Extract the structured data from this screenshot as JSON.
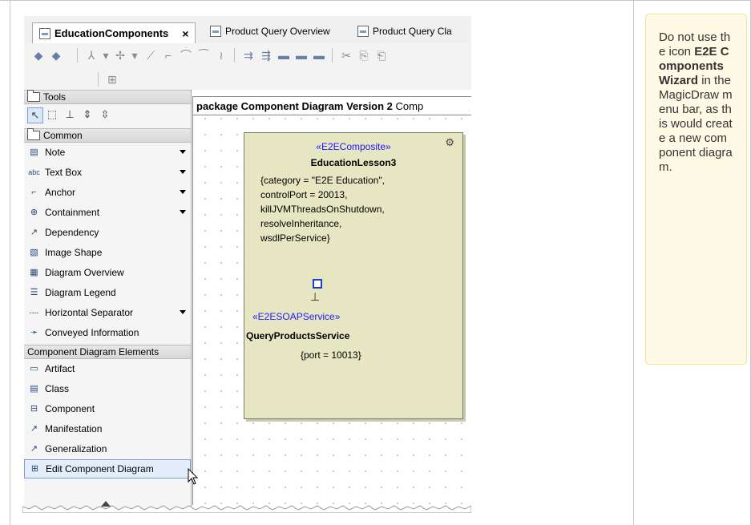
{
  "tabs": [
    {
      "label": "EducationComponents",
      "close": "×",
      "active": true
    },
    {
      "label": "Product Query Overview"
    },
    {
      "label": "Product Query Cla"
    }
  ],
  "palette": {
    "groups": [
      {
        "label": "Tools"
      },
      {
        "label": "Common"
      },
      {
        "label": "Component Diagram Elements"
      }
    ],
    "common_items": [
      {
        "label": "Note",
        "icon": "note-icon",
        "glyph": "▤",
        "dropdown": true
      },
      {
        "label": "Text Box",
        "icon": "text-box-icon",
        "glyph": "abc",
        "dropdown": true
      },
      {
        "label": "Anchor",
        "icon": "anchor-icon",
        "glyph": "⌐",
        "dropdown": true
      },
      {
        "label": "Containment",
        "icon": "containment-icon",
        "glyph": "⊕",
        "dropdown": true
      },
      {
        "label": "Dependency",
        "icon": "dependency-icon",
        "glyph": "↗",
        "dropdown": false
      },
      {
        "label": "Image Shape",
        "icon": "image-shape-icon",
        "glyph": "▧",
        "dropdown": false
      },
      {
        "label": "Diagram Overview",
        "icon": "diagram-overview-icon",
        "glyph": "▦",
        "dropdown": false
      },
      {
        "label": "Diagram Legend",
        "icon": "diagram-legend-icon",
        "glyph": "☰",
        "dropdown": false
      },
      {
        "label": "Horizontal Separator",
        "icon": "horizontal-separator-icon",
        "glyph": "----",
        "dropdown": true
      },
      {
        "label": "Conveyed Information",
        "icon": "conveyed-information-icon",
        "glyph": "➛",
        "dropdown": false
      }
    ],
    "component_items": [
      {
        "label": "Artifact",
        "icon": "artifact-icon",
        "glyph": "▭"
      },
      {
        "label": "Class",
        "icon": "class-icon",
        "glyph": "▤"
      },
      {
        "label": "Component",
        "icon": "component-icon",
        "glyph": "⊟"
      },
      {
        "label": "Manifestation",
        "icon": "manifestation-icon",
        "glyph": "↗"
      },
      {
        "label": "Generalization",
        "icon": "generalization-icon",
        "glyph": "↗"
      },
      {
        "label": "Edit Component Diagram",
        "icon": "edit-component-diagram-icon",
        "glyph": "⊞"
      }
    ]
  },
  "diagram": {
    "title_bold": "package Component Diagram Version 2",
    "title_rest": "Comp",
    "component": {
      "stereotype": "«E2EComposite»",
      "name": "EducationLesson3",
      "tagged_values": "{category = \"E2E Education\",\ncontrolPort = 20013,\nkillJVMThreadsOnShutdown,\nresolveInheritance,\nwsdlPerService}"
    },
    "service": {
      "stereotype": "«E2ESOAPService»",
      "name": "QueryProductsService",
      "tagged_values": "{port = 10013}"
    }
  },
  "note": {
    "text_before": "Do not use the icon ",
    "bold": "E2E Components Wizard",
    "text_after": " in the MagicDraw menu bar, as this would create a new component diagram."
  }
}
